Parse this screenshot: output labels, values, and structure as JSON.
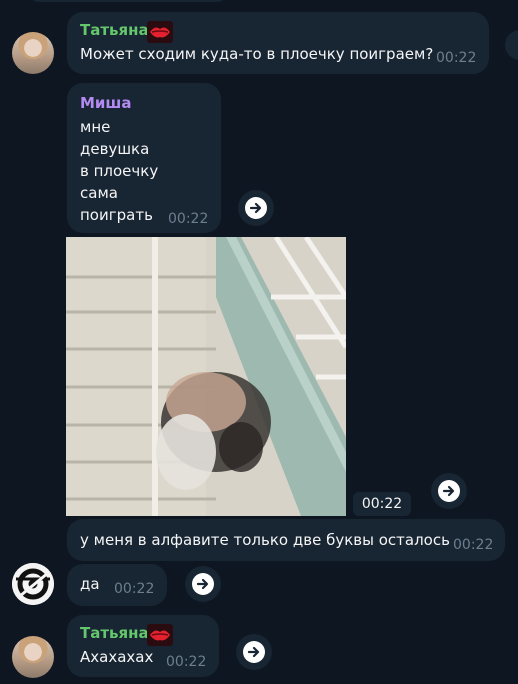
{
  "messages": [
    {
      "sender": "Татьяна",
      "text": "Может сходим куда-то в плоечку поиграем?",
      "time": "00:22"
    },
    {
      "sender": "Миша",
      "text": "мне\nдевушка\nв плоечку\nсама\nпоиграть",
      "time": "00:22"
    },
    {
      "media": "gif",
      "time": "00:22"
    },
    {
      "text": "у меня в алфавите только две буквы осталось",
      "time": "00:22"
    },
    {
      "text": "да",
      "time": "00:22"
    },
    {
      "sender": "Татьяна",
      "text": "Ахахахах",
      "time": "00:22"
    }
  ],
  "colors": {
    "background": "#0e1621",
    "bubble": "#182533",
    "tatiana_name": "#65c76b",
    "misha_name": "#b38bf1",
    "time": "#6d7f8f"
  },
  "icons": [
    "forward-icon",
    "lips-emoji",
    "avatar-logo-icon"
  ]
}
